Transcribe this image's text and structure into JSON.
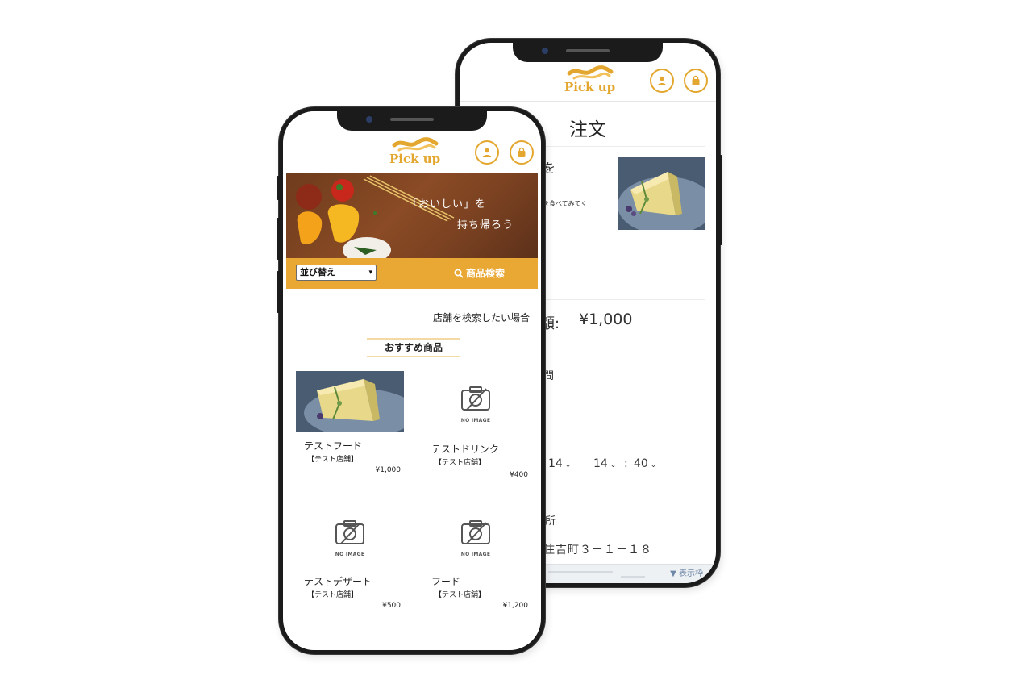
{
  "brand": {
    "name": "Pick up",
    "accent_color": "#e3a72f",
    "toolbar_color": "#e9a734"
  },
  "header": {
    "icons": [
      "user-icon",
      "bag-icon"
    ]
  },
  "back_screen": {
    "title": "注文",
    "fragment_top": "を",
    "fragment_desc": "を食べてみてく",
    "fragment_total_label": "額:",
    "total": "¥1,000",
    "fragment_time_label": "間",
    "time": {
      "date": "14",
      "hour": "14",
      "separator": ":",
      "minute": "40"
    },
    "fragment_place_label": "所",
    "address_fragment": "住吉町３－１－１８",
    "map_label": "▼ 表示枠"
  },
  "front_screen": {
    "hero": {
      "line1": "「おいしい」を",
      "line2": "持ち帰ろう"
    },
    "toolbar": {
      "sort_label": "並び替え",
      "search_label": "商品検索"
    },
    "store_search_text": "店舗を検索したい場合",
    "recommended_heading": "おすすめ商品",
    "no_image_text": "NO IMAGE",
    "products": [
      {
        "name": "テストフード",
        "store": "【テスト店舗】",
        "price": "¥1,000",
        "has_image": true
      },
      {
        "name": "テストドリンク",
        "store": "【テスト店舗】",
        "price": "¥400",
        "has_image": false
      },
      {
        "name": "テストデザート",
        "store": "【テスト店舗】",
        "price": "¥500",
        "has_image": false
      },
      {
        "name": "フード",
        "store": "【テスト店舗】",
        "price": "¥1,200",
        "has_image": false
      }
    ]
  }
}
